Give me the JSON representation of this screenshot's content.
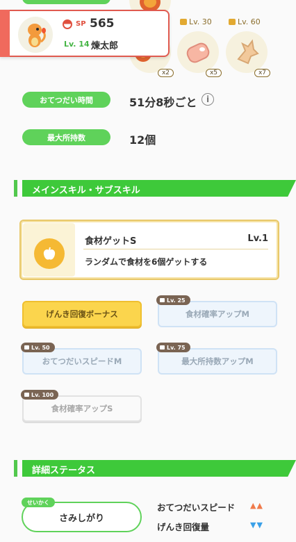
{
  "pokemon": {
    "sp_label": "SP",
    "sp_value": "565",
    "level": "Lv. 14",
    "name": "煉太郎"
  },
  "ingredients": [
    {
      "icon": "fire-fruit-icon",
      "count": "x2",
      "unlock": ""
    },
    {
      "icon": "meat-icon",
      "count": "x5",
      "unlock": "Lv. 30"
    },
    {
      "icon": "ginger-icon",
      "count": "x7",
      "unlock": "Lv. 60"
    }
  ],
  "stats": {
    "help_time_label": "おてつだい時間",
    "help_time_value": "51分8秒ごと",
    "info_glyph": "i",
    "max_carry_label": "最大所持数",
    "max_carry_value": "12個"
  },
  "sections": {
    "skills_title": "メインスキル・サブスキル",
    "detail_title": "詳細ステータス"
  },
  "main_skill": {
    "name": "食材ゲットS",
    "level": "Lv.1",
    "description": "ランダムで食材を6個ゲットする"
  },
  "sub_skills": [
    {
      "label": "げんき回復ボーナス",
      "unlock": "",
      "style": "gold"
    },
    {
      "label": "食材確率アップM",
      "unlock": "Lv. 25",
      "style": "blue"
    },
    {
      "label": "おてつだいスピードM",
      "unlock": "Lv. 50",
      "style": "blue"
    },
    {
      "label": "最大所持数アップM",
      "unlock": "Lv. 75",
      "style": "blue"
    },
    {
      "label": "食材確率アップS",
      "unlock": "Lv. 100",
      "style": "white"
    }
  ],
  "nature": {
    "tag": "せいかく",
    "value": "さみしがり",
    "up_label": "おてつだいスピード",
    "up_arrows": "▲▲",
    "down_label": "げんき回復量",
    "down_arrows": "▼▼"
  },
  "colors": {
    "accent_green": "#3ec93a",
    "up_color": "#f07a4a",
    "down_color": "#3aa0e8",
    "gold": "#fbd54d"
  }
}
